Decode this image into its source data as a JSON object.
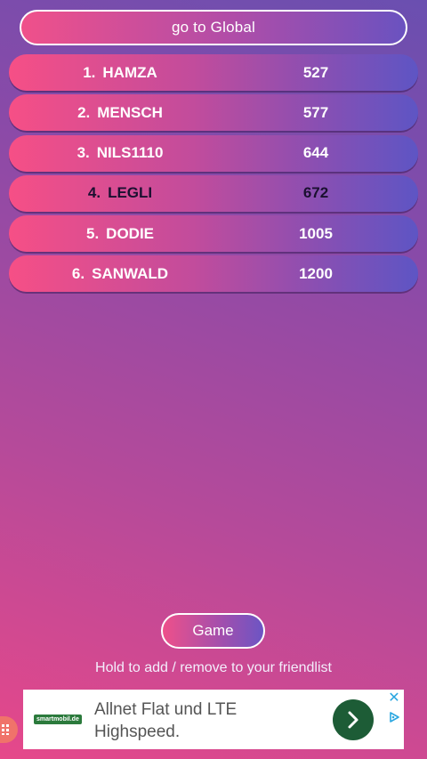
{
  "header": {
    "global_label": "go to Global"
  },
  "leaderboard": [
    {
      "rank": "1.",
      "name": "HAMZA",
      "score": "527"
    },
    {
      "rank": "2.",
      "name": "MENSCH",
      "score": "577"
    },
    {
      "rank": "3.",
      "name": "NILS1110",
      "score": "644"
    },
    {
      "rank": "4.",
      "name": "LEGLI",
      "score": "672"
    },
    {
      "rank": "5.",
      "name": "DODIE",
      "score": "1005"
    },
    {
      "rank": "6.",
      "name": "SANWALD",
      "score": "1200"
    }
  ],
  "footer": {
    "game_label": "Game",
    "hint": "Hold to add / remove to your friendlist"
  },
  "ad": {
    "brand": "smartmobil.de",
    "text": "Allnet Flat und LTE Highspeed."
  },
  "colors": {
    "accent_pink": "#f64f86",
    "accent_blue": "#5e55c4",
    "ad_button": "#1d5c36",
    "close_blue": "#29a6e0"
  }
}
